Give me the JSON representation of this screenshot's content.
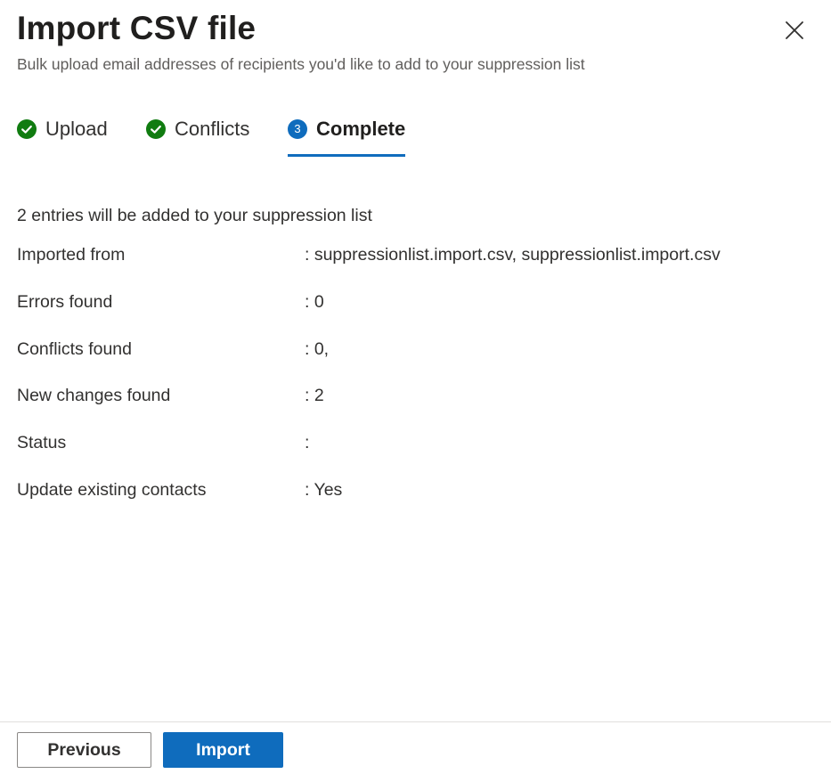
{
  "panel": {
    "title": "Import CSV file",
    "subtitle": "Bulk upload email addresses of recipients you'd like to add to your suppression list",
    "close_icon": "close-icon"
  },
  "steps": [
    {
      "label": "Upload",
      "state": "completed",
      "icon": "check-circle-icon"
    },
    {
      "label": "Conflicts",
      "state": "completed",
      "icon": "check-circle-icon"
    },
    {
      "label": "Complete",
      "state": "active",
      "number": "3"
    }
  ],
  "summary": "2 entries will be added to your suppression list",
  "details": [
    {
      "label": "Imported from",
      "value": ": suppressionlist.import.csv, suppressionlist.import.csv"
    },
    {
      "label": "Errors found",
      "value": ": 0"
    },
    {
      "label": "Conflicts found",
      "value": ": 0,"
    },
    {
      "label": "New changes found",
      "value": ": 2"
    },
    {
      "label": "Status",
      "value": ":"
    },
    {
      "label": "Update existing contacts",
      "value": ": Yes"
    }
  ],
  "footer": {
    "previous_label": "Previous",
    "import_label": "Import"
  },
  "colors": {
    "accent": "#0f6cbd",
    "success": "#107c10",
    "text": "#323130",
    "subtle_text": "#605e5c",
    "divider": "#e1dfdd"
  }
}
